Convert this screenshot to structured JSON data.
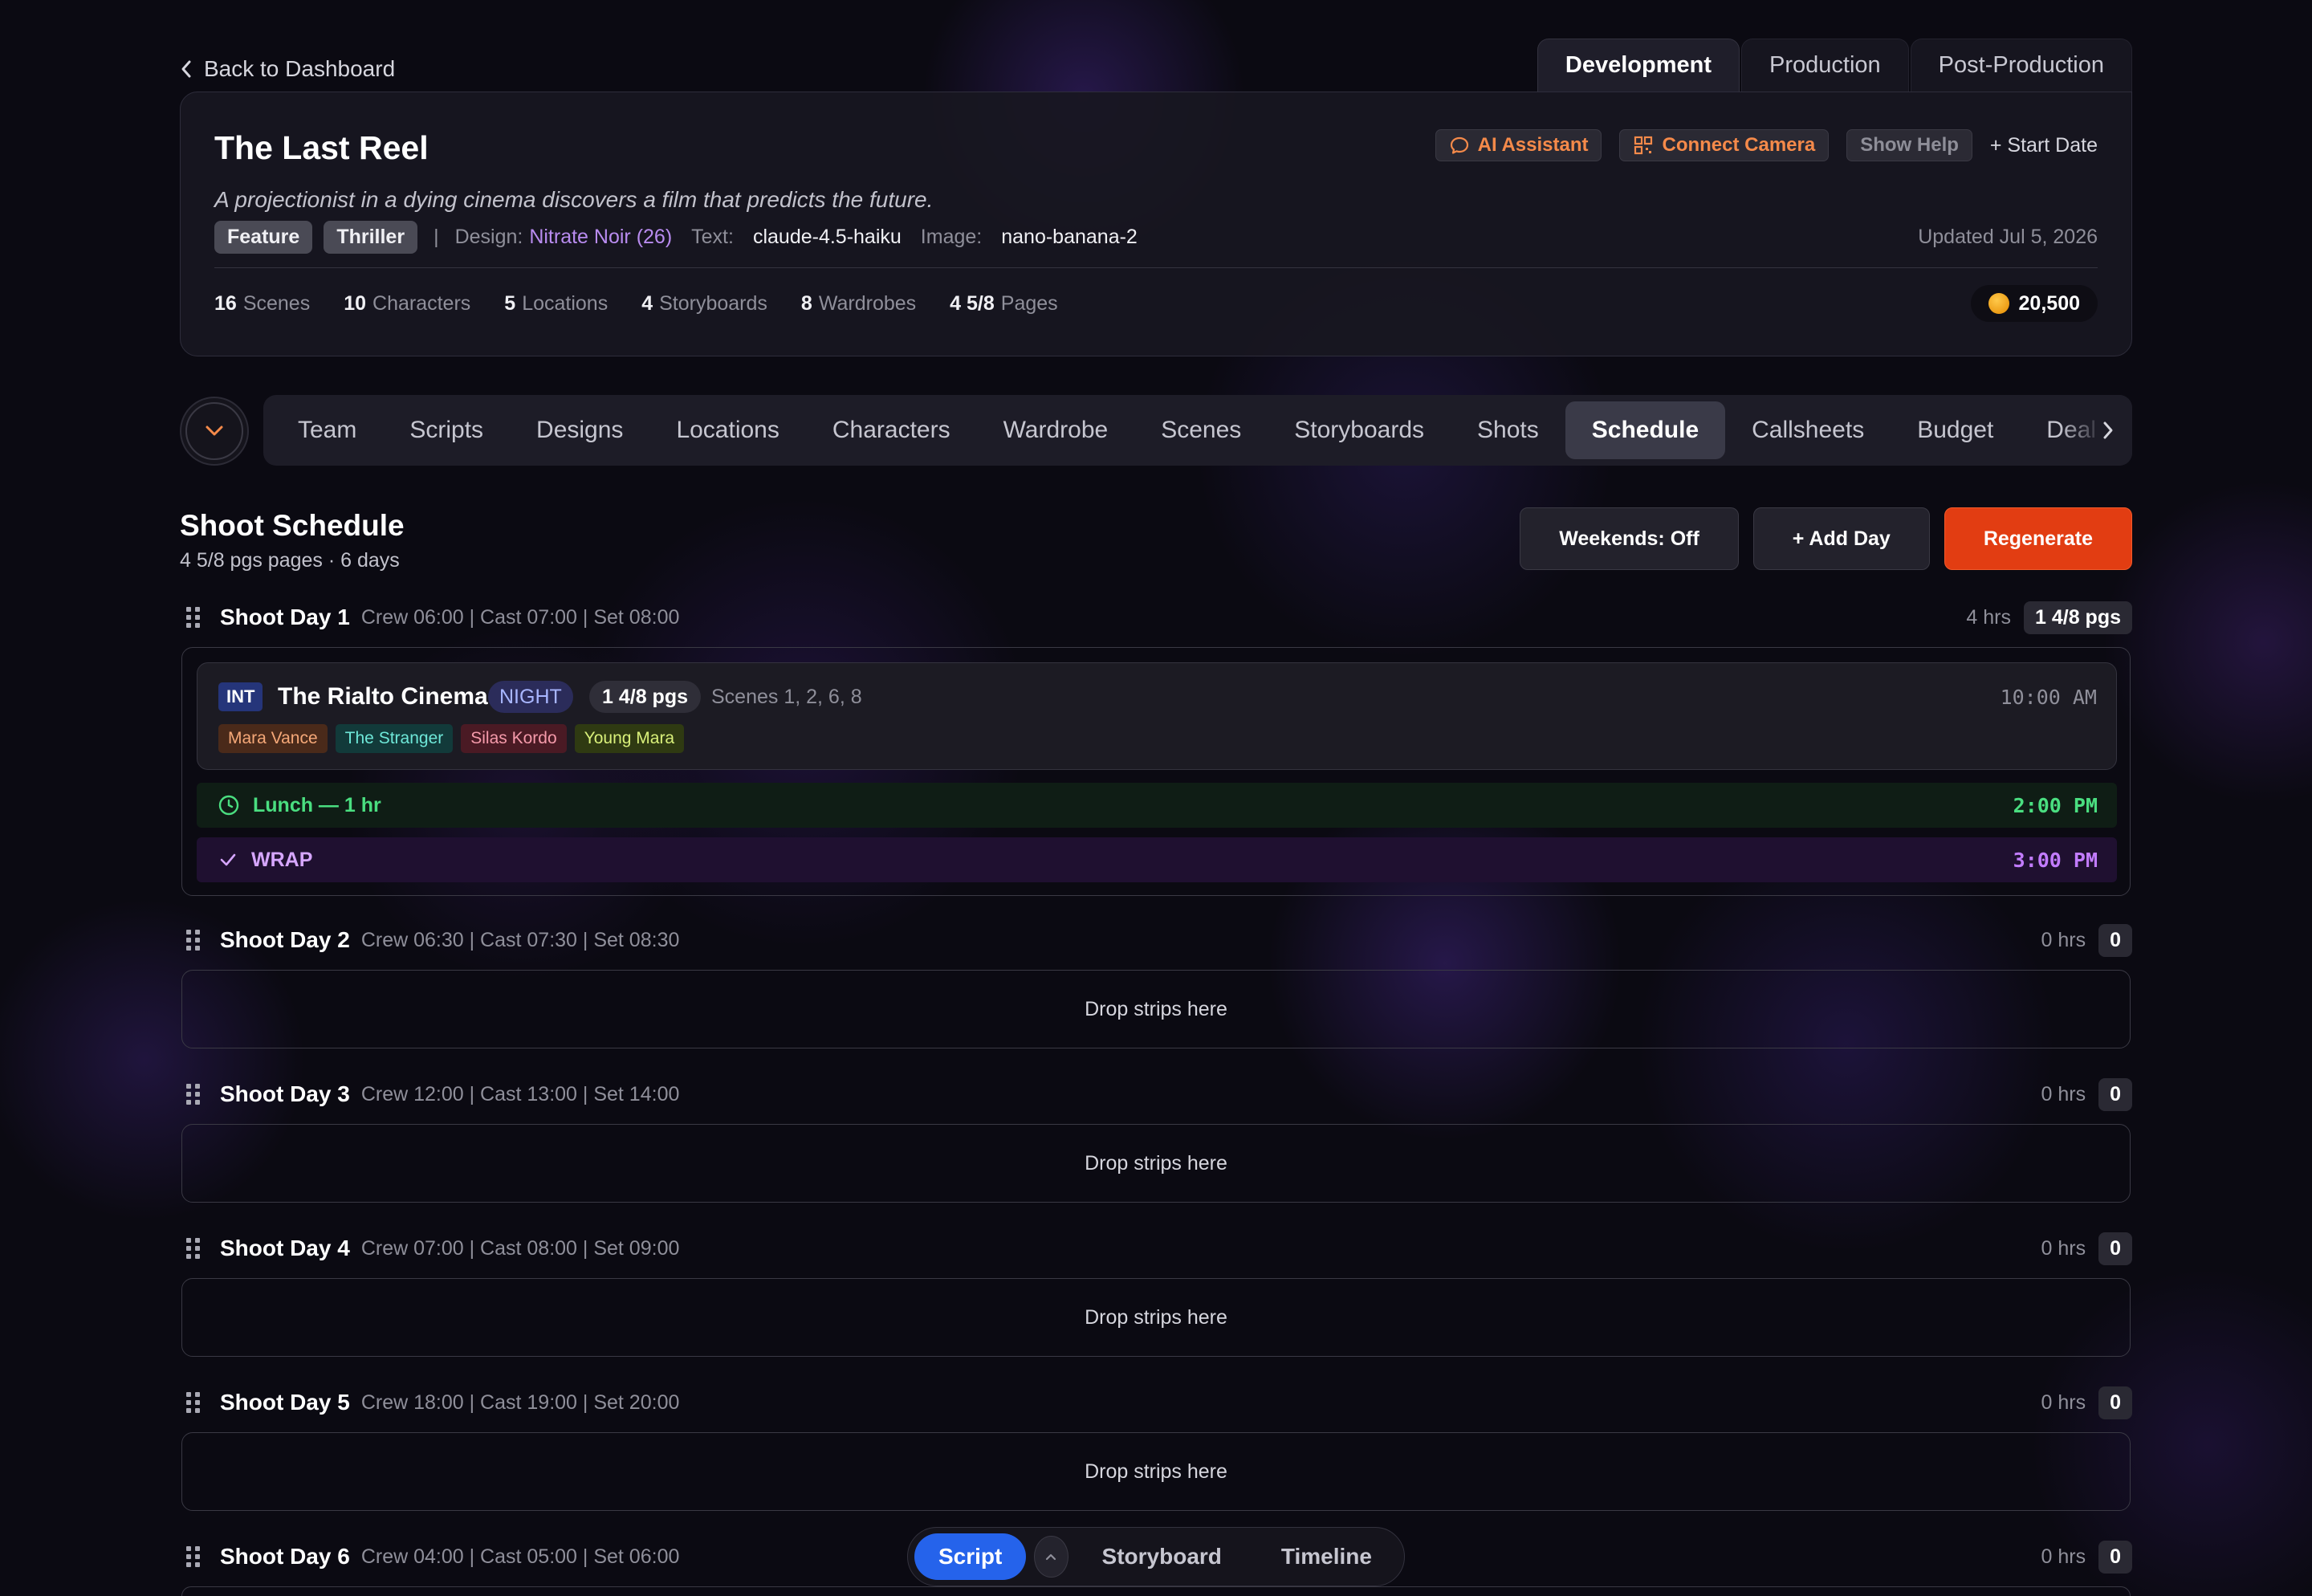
{
  "back_label": "Back to Dashboard",
  "phase_tabs": [
    {
      "label": "Development",
      "active": true
    },
    {
      "label": "Production",
      "active": false
    },
    {
      "label": "Post-Production",
      "active": false
    }
  ],
  "project": {
    "title": "The Last Reel",
    "logline": "A projectionist in a dying cinema discovers a film that predicts the future.",
    "tags": [
      "Feature",
      "Thriller"
    ],
    "separator": "|",
    "design_label": "Design:",
    "design_value": "Nitrate Noir (26)",
    "text_label": "Text:",
    "text_value": "claude-4.5-haiku",
    "image_label": "Image:",
    "image_value": "nano-banana-2",
    "updated": "Updated Jul 5, 2026",
    "actions": {
      "ai_assistant": "AI Assistant",
      "connect_camera": "Connect Camera",
      "show_help": "Show Help",
      "start_date": "+ Start Date"
    },
    "stats": [
      {
        "value": "16",
        "label": "Scenes"
      },
      {
        "value": "10",
        "label": "Characters"
      },
      {
        "value": "5",
        "label": "Locations"
      },
      {
        "value": "4",
        "label": "Storyboards"
      },
      {
        "value": "8",
        "label": "Wardrobes"
      },
      {
        "value": "4 5/8",
        "label": "Pages"
      }
    ],
    "coins": "20,500"
  },
  "nav": {
    "items": [
      "Team",
      "Scripts",
      "Designs",
      "Locations",
      "Characters",
      "Wardrobe",
      "Scenes",
      "Storyboards",
      "Shots",
      "Schedule",
      "Callsheets",
      "Budget",
      "Deal"
    ],
    "active": "Schedule"
  },
  "schedule": {
    "title": "Shoot Schedule",
    "subtitle": "4 5/8 pgs pages · 6 days",
    "buttons": {
      "weekends": "Weekends: Off",
      "add_day": "+ Add Day",
      "regenerate": "Regenerate"
    },
    "drop_text": "Drop strips here",
    "days": [
      {
        "name": "Shoot Day 1",
        "calls": "Crew 06:00 | Cast 07:00 | Set 08:00",
        "hours": "4 hrs",
        "pages": "1 4/8 pgs",
        "strip": {
          "int_ext": "INT",
          "location": "The Rialto Cinema",
          "time_of_day": "NIGHT",
          "pages": "1 4/8 pgs",
          "scenes": "Scenes 1, 2, 6, 8",
          "time": "10:00 AM",
          "characters": [
            {
              "name": "Mara Vance",
              "bg": "#4a2a1a",
              "fg": "#f5a878"
            },
            {
              "name": "The Stranger",
              "bg": "#123a3a",
              "fg": "#6ee7d8"
            },
            {
              "name": "Silas Kordo",
              "bg": "#4a1a24",
              "fg": "#f59aaa"
            },
            {
              "name": "Young Mara",
              "bg": "#2f3a12",
              "fg": "#d9f07a"
            }
          ]
        },
        "lunch": {
          "label": "Lunch — 1 hr",
          "time": "2:00 PM"
        },
        "wrap": {
          "label": "WRAP",
          "time": "3:00 PM"
        }
      },
      {
        "name": "Shoot Day 2",
        "calls": "Crew 06:30 | Cast 07:30 | Set 08:30",
        "hours": "0 hrs",
        "pages": "0"
      },
      {
        "name": "Shoot Day 3",
        "calls": "Crew 12:00 | Cast 13:00 | Set 14:00",
        "hours": "0 hrs",
        "pages": "0"
      },
      {
        "name": "Shoot Day 4",
        "calls": "Crew 07:00 | Cast 08:00 | Set 09:00",
        "hours": "0 hrs",
        "pages": "0"
      },
      {
        "name": "Shoot Day 5",
        "calls": "Crew 18:00 | Cast 19:00 | Set 20:00",
        "hours": "0 hrs",
        "pages": "0"
      },
      {
        "name": "Shoot Day 6",
        "calls": "Crew 04:00 | Cast 05:00 | Set 06:00",
        "hours": "0 hrs",
        "pages": "0"
      }
    ]
  },
  "bottom_bar": {
    "active": "Script",
    "items": [
      "Storyboard",
      "Timeline"
    ]
  }
}
